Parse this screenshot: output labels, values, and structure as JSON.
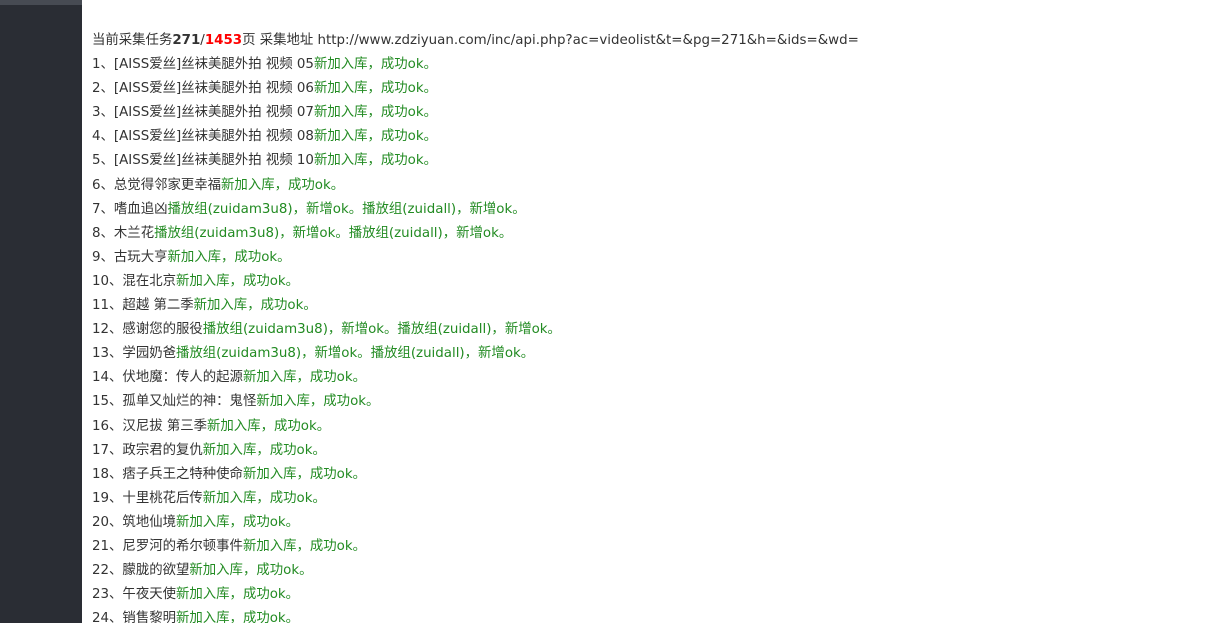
{
  "header": {
    "prefix": "当前采集任务",
    "current_page": "271",
    "separator": "/",
    "total_pages": "1453",
    "suffix": "页 采集地址 http://www.zdziyuan.com/inc/api.php?ac=videolist&t=&pg=271&h=&ids=&wd="
  },
  "items": [
    {
      "prefix": "1、[AISS爱丝]丝袜美腿外拍 视频 05",
      "status": "新加入库，成功ok。"
    },
    {
      "prefix": "2、[AISS爱丝]丝袜美腿外拍 视频 06",
      "status": "新加入库，成功ok。"
    },
    {
      "prefix": "3、[AISS爱丝]丝袜美腿外拍 视频 07",
      "status": "新加入库，成功ok。"
    },
    {
      "prefix": "4、[AISS爱丝]丝袜美腿外拍 视频 08",
      "status": "新加入库，成功ok。"
    },
    {
      "prefix": "5、[AISS爱丝]丝袜美腿外拍 视频 10",
      "status": "新加入库，成功ok。"
    },
    {
      "prefix": "6、总觉得邻家更幸福",
      "status": "新加入库，成功ok。"
    },
    {
      "prefix": "7、嗜血追凶",
      "status": "播放组(zuidam3u8)，新增ok。播放组(zuidall)，新增ok。"
    },
    {
      "prefix": "8、木兰花",
      "status": "播放组(zuidam3u8)，新增ok。播放组(zuidall)，新增ok。"
    },
    {
      "prefix": "9、古玩大亨",
      "status": "新加入库，成功ok。"
    },
    {
      "prefix": "10、混在北京",
      "status": "新加入库，成功ok。"
    },
    {
      "prefix": "11、超越 第二季",
      "status": "新加入库，成功ok。"
    },
    {
      "prefix": "12、感谢您的服役",
      "status": "播放组(zuidam3u8)，新增ok。播放组(zuidall)，新增ok。"
    },
    {
      "prefix": "13、学园奶爸",
      "status": "播放组(zuidam3u8)，新增ok。播放组(zuidall)，新增ok。"
    },
    {
      "prefix": "14、伏地魔：传人的起源",
      "status": "新加入库，成功ok。"
    },
    {
      "prefix": "15、孤单又灿烂的神：鬼怪",
      "status": "新加入库，成功ok。"
    },
    {
      "prefix": "16、汉尼拔 第三季",
      "status": "新加入库，成功ok。"
    },
    {
      "prefix": "17、政宗君的复仇",
      "status": "新加入库，成功ok。"
    },
    {
      "prefix": "18、痞子兵王之特种使命",
      "status": "新加入库，成功ok。"
    },
    {
      "prefix": "19、十里桃花后传",
      "status": "新加入库，成功ok。"
    },
    {
      "prefix": "20、筑地仙境",
      "status": "新加入库，成功ok。"
    },
    {
      "prefix": "21、尼罗河的希尔顿事件",
      "status": "新加入库，成功ok。"
    },
    {
      "prefix": "22、朦胧的欲望",
      "status": "新加入库，成功ok。"
    },
    {
      "prefix": "23、午夜天使",
      "status": "新加入库，成功ok。"
    },
    {
      "prefix": "24、销售黎明",
      "status": "新加入库，成功ok。"
    }
  ],
  "colors": {
    "sidebar": "#2a2d34",
    "text": "#333333",
    "total_pages": "#ff0000",
    "ok_status": "#228b22"
  }
}
